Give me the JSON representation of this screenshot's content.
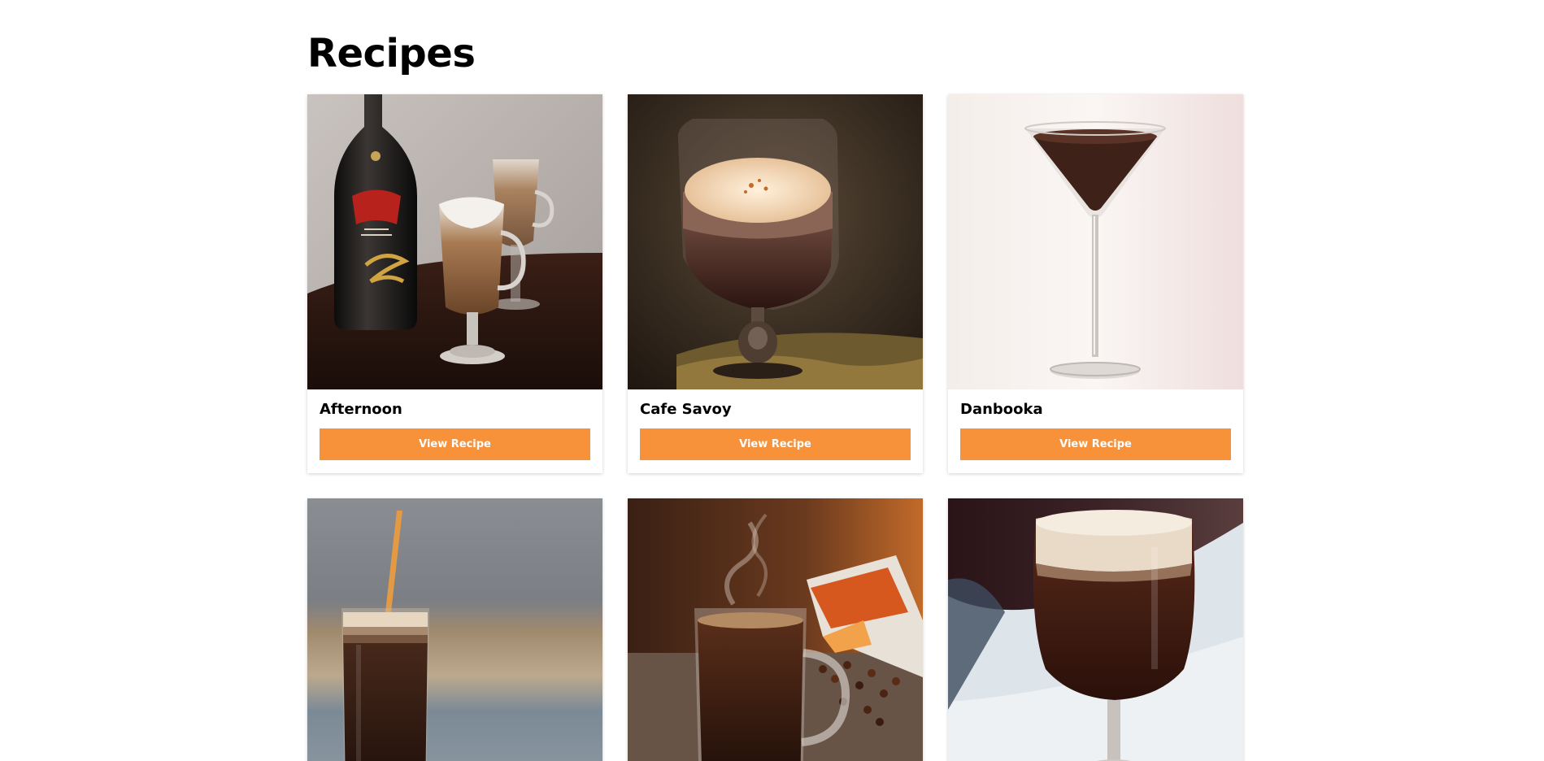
{
  "page": {
    "title": "Recipes"
  },
  "recipes": [
    {
      "name": "Afternoon",
      "button_label": "View Recipe",
      "image": "baileys-coffee-glasses"
    },
    {
      "name": "Cafe Savoy",
      "button_label": "View Recipe",
      "image": "layered-coffee-goblet"
    },
    {
      "name": "Danbooka",
      "button_label": "View Recipe",
      "image": "coffee-martini-glass"
    },
    {
      "name": "",
      "button_label": "",
      "image": "iced-coffee-with-straw"
    },
    {
      "name": "",
      "button_label": "",
      "image": "steaming-coffee-mug-with-beans"
    },
    {
      "name": "",
      "button_label": "",
      "image": "coffee-in-wine-glass"
    }
  ],
  "colors": {
    "accent": "#f7923a",
    "text": "#000000",
    "background": "#ffffff"
  }
}
